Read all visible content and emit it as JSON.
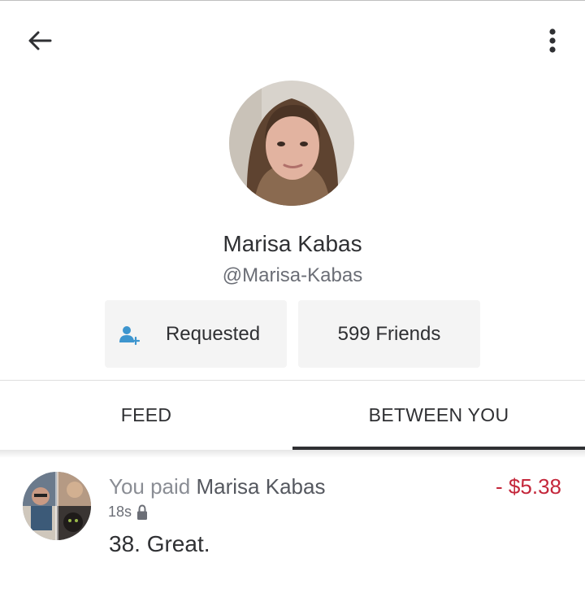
{
  "header": {
    "back_icon": "arrow-left-icon",
    "menu_icon": "more-vertical-icon"
  },
  "profile": {
    "name": "Marisa Kabas",
    "handle": "@Marisa-Kabas",
    "friend_status_label": "Requested",
    "friend_status_icon": "person-add-icon",
    "friends_label": "599 Friends"
  },
  "tabs": [
    {
      "label": "FEED",
      "active": false
    },
    {
      "label": "BETWEEN YOU",
      "active": true
    }
  ],
  "transactions": [
    {
      "prefix": "You paid ",
      "counterparty": "Marisa Kabas",
      "amount": "- $5.38",
      "time": "18s",
      "privacy_icon": "lock-icon",
      "note": "38. Great."
    }
  ],
  "colors": {
    "text": "#2f3033",
    "muted": "#6b6e76",
    "negative_amount": "#c4273b",
    "pill_bg": "#f4f4f4",
    "accent_icon": "#3d95ce"
  }
}
